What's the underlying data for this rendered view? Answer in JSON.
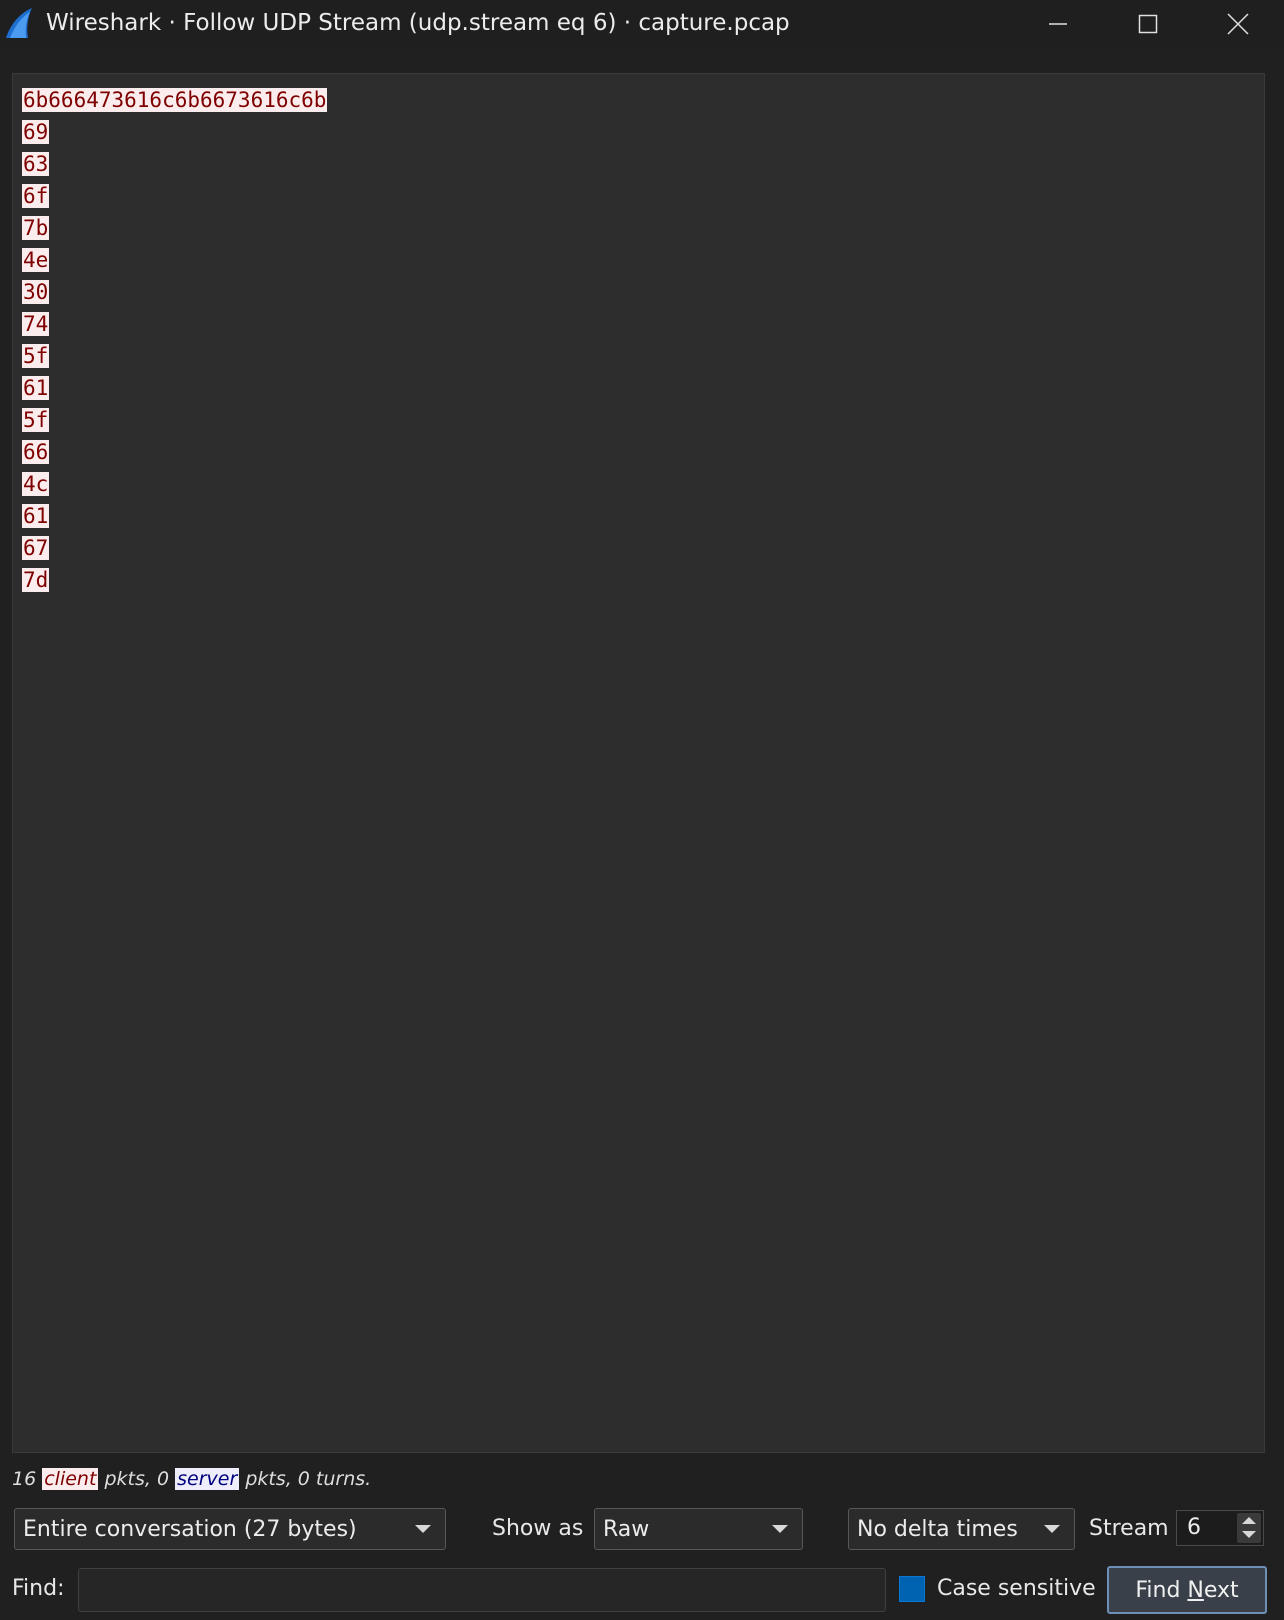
{
  "window": {
    "title": "Wireshark · Follow UDP Stream (udp.stream eq 6) · capture.pcap",
    "icon": "wireshark-fin-icon",
    "controls": [
      "minimize-icon",
      "maximize-icon",
      "close-icon"
    ]
  },
  "stream": {
    "lines": [
      "6b666473616c6b6673616c6b",
      "69",
      "63",
      "6f",
      "7b",
      "4e",
      "30",
      "74",
      "5f",
      "61",
      "5f",
      "66",
      "4c",
      "61",
      "67",
      "7d"
    ],
    "client_bg": "#fbeded",
    "client_fg": "#7f0000"
  },
  "stats": {
    "client_count": "16",
    "client_label": "client",
    "mid_text": "pkts, 0",
    "server_label": "server",
    "tail_text": "pkts, 0 turns."
  },
  "controls": {
    "conversation_value": "Entire conversation (27 bytes)",
    "show_as_label": "Show as",
    "show_as_value": "Raw",
    "delta_value": "No delta times",
    "stream_label": "Stream",
    "stream_value": "6"
  },
  "find": {
    "label": "Find:",
    "value": "",
    "case_label": "Case sensitive",
    "case_checked": true,
    "button_pre": "Find ",
    "button_mnemonic": "N",
    "button_post": "ext"
  }
}
